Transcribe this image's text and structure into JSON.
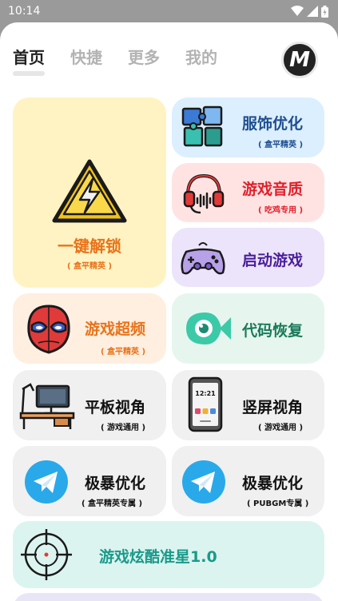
{
  "status": {
    "time": "10:14"
  },
  "tabs": [
    {
      "label": "首页",
      "active": true
    },
    {
      "label": "快捷",
      "active": false
    },
    {
      "label": "更多",
      "active": false
    },
    {
      "label": "我的",
      "active": false
    }
  ],
  "avatar": {
    "letter": "M"
  },
  "cards": {
    "unlock": {
      "title": "一键解锁",
      "sub": "( 盒平精英 )"
    },
    "clothing": {
      "title": "服饰优化",
      "sub": "( 盒平精英 )"
    },
    "audio": {
      "title": "游戏音质",
      "sub": "( 吃鸡专用 )"
    },
    "launch": {
      "title": "启动游戏"
    },
    "overclock": {
      "title": "游戏超频",
      "sub": "( 盒平精英 )"
    },
    "code": {
      "title": "代码恢复"
    },
    "tablet": {
      "title": "平板视角",
      "sub": "( 游戏通用 )"
    },
    "portrait": {
      "title": "竖屏视角",
      "sub": "( 游戏通用 )",
      "phone_time": "12:21"
    },
    "boost1": {
      "title": "极暴优化",
      "sub": "( 盒平精英专属 )"
    },
    "boost2": {
      "title": "极暴优化",
      "sub": "( PUBGM专属 )"
    },
    "crosshair": {
      "title": "游戏炫酷准星1.0"
    }
  },
  "colors": {
    "unlock_bg": "#fff3c4",
    "unlock_text": "#e8731a",
    "clothing_bg": "#dcefff",
    "clothing_text": "#1f4e8f",
    "audio_bg": "#ffe3e3",
    "audio_text": "#e0202a",
    "launch_bg": "#ece4fb",
    "launch_text": "#4a1f9a",
    "overclock_bg": "#ffefe0",
    "overclock_text": "#e8731a",
    "code_bg": "#e6f6ee",
    "code_text": "#1a7a5a",
    "gray_bg": "#f0f0f0",
    "dark_text": "#111111",
    "crosshair_bg": "#dcf4ef",
    "crosshair_text": "#1a9a8a"
  }
}
